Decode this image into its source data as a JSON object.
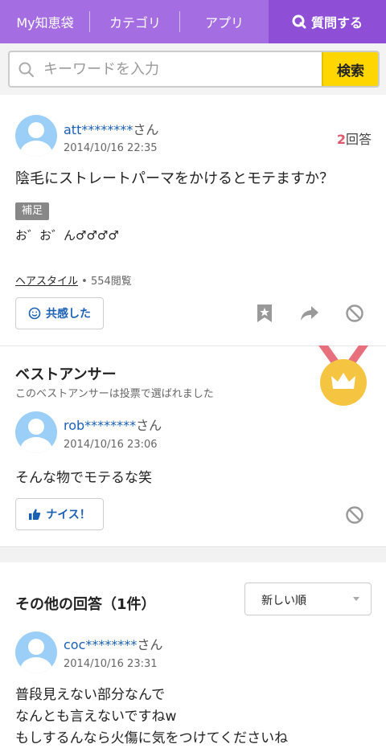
{
  "nav": {
    "mybox": "My知恵袋",
    "category": "カテゴリ",
    "apps": "アプリ",
    "ask": "質問する"
  },
  "search": {
    "placeholder": "キーワードを入力",
    "button": "検索"
  },
  "question": {
    "user": "att********",
    "honorific": "さん",
    "date": "2014/10/16 22:35",
    "answer_count": "2",
    "answer_count_label": "回答",
    "title": "陰毛にストレートパーマをかけるとモテますか？",
    "supplement_label": "補足",
    "supplement_text": "お゛お゛ん♂♂♂♂",
    "category": "ヘアスタイル",
    "views": "554閲覧",
    "empathy_label": "共感した"
  },
  "best_answer": {
    "heading": "ベストアンサー",
    "note": "このベストアンサーは投票で選ばれました",
    "user": "rob********",
    "honorific": "さん",
    "date": "2014/10/16 23:06",
    "text": "そんな物でモテるな笑",
    "nice_label": "ナイス！"
  },
  "other_answers": {
    "heading": "その他の回答（1件）",
    "sort_selected": "新しい順",
    "items": [
      {
        "user": "coc********",
        "honorific": "さん",
        "date": "2014/10/16 23:31",
        "lines": [
          "普段見えない部分なんで",
          "なんとも言えないですねw",
          "もしするんなら火傷に気をつけてくださいね"
        ]
      }
    ]
  },
  "colors": {
    "nav": "#a56de2",
    "ask": "#8e4fd6",
    "search_button": "#ffd600",
    "link": "#1a5fb4",
    "answer_count": "#e0586b",
    "medal": "#f5c542",
    "ribbon": "#e8707c"
  }
}
